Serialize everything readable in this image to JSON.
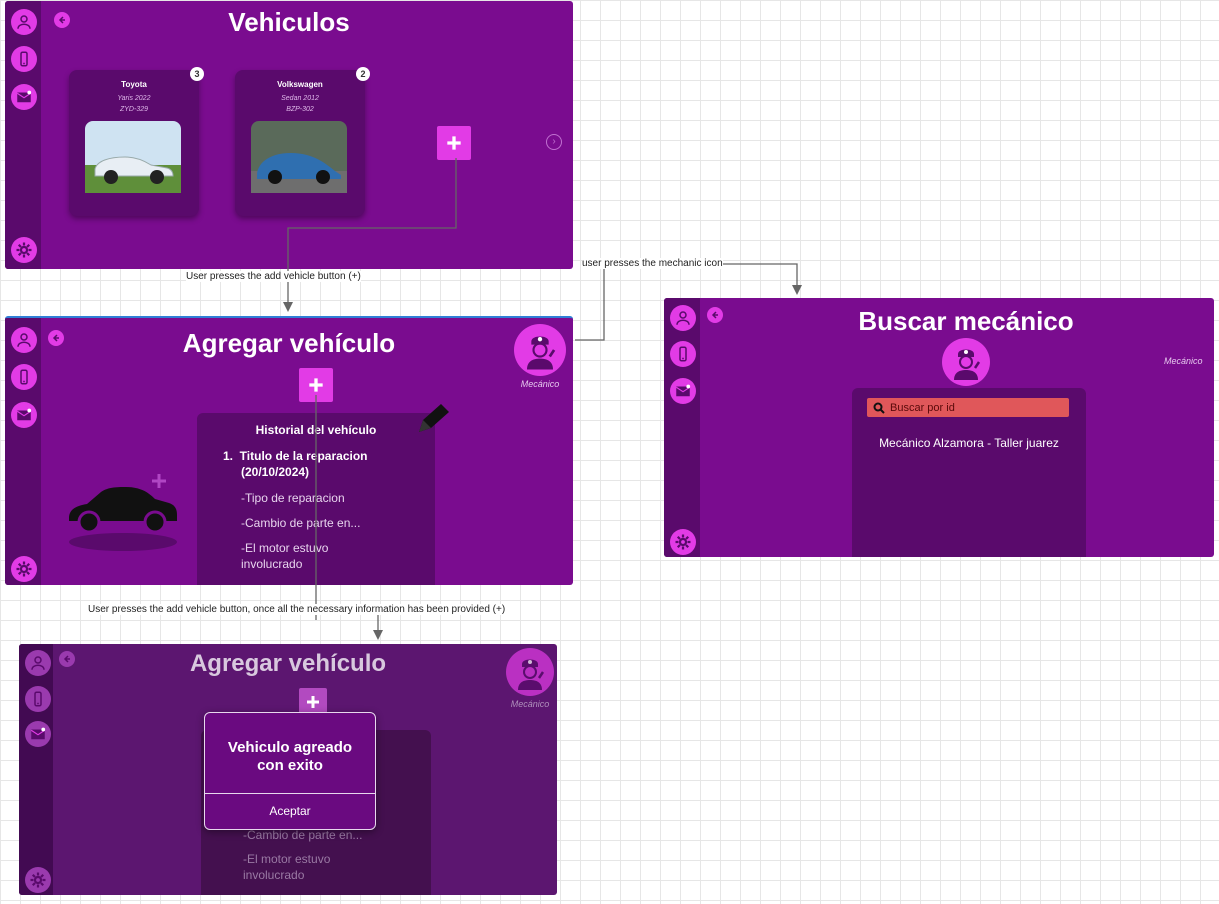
{
  "screen1": {
    "title": "Vehiculos",
    "cards": [
      {
        "name": "Toyota",
        "model": "Yaris 2022",
        "plate": "ZYD-329",
        "badge": "3"
      },
      {
        "name": "Volkswagen",
        "model": "Sedan 2012",
        "plate": "BZP-302",
        "badge": "2"
      }
    ]
  },
  "screen2": {
    "title": "Agregar vehículo",
    "mechanic_label": "Mecánico",
    "history_title": "Historial del vehículo",
    "item_title": "1.  Titulo de la reparacion",
    "item_date": "(20/10/2024)",
    "line1": "-Tipo de reparacion",
    "line2": "-Cambio de parte en...",
    "line3a": "-El motor estuvo",
    "line3b": "involucrado"
  },
  "screen3": {
    "title": "Buscar mecánico",
    "mechanic_label": "Mecánico",
    "search_placeholder": "Buscar por id",
    "result": "Mecánico Alzamora - Taller juarez"
  },
  "screen4": {
    "title": "Agregar vehículo",
    "mechanic_label": "Mecánico",
    "dialog_message": "Vehiculo agreado con exito",
    "accept_label": "Aceptar",
    "line2": "-Cambio de parte en...",
    "line3a": "-El motor estuvo",
    "line3b": "involucrado"
  },
  "annotations": {
    "a1": "User presses the add vehicle button (+)",
    "a2": "user presses the mechanic icon",
    "a3": "User presses the add vehicle button, once all the necessary information has been provided (+)"
  },
  "colors": {
    "primary": "#7a0c8f",
    "sidebar": "#5a0a6c",
    "accent": "#e23be6",
    "search": "#e0575a"
  }
}
